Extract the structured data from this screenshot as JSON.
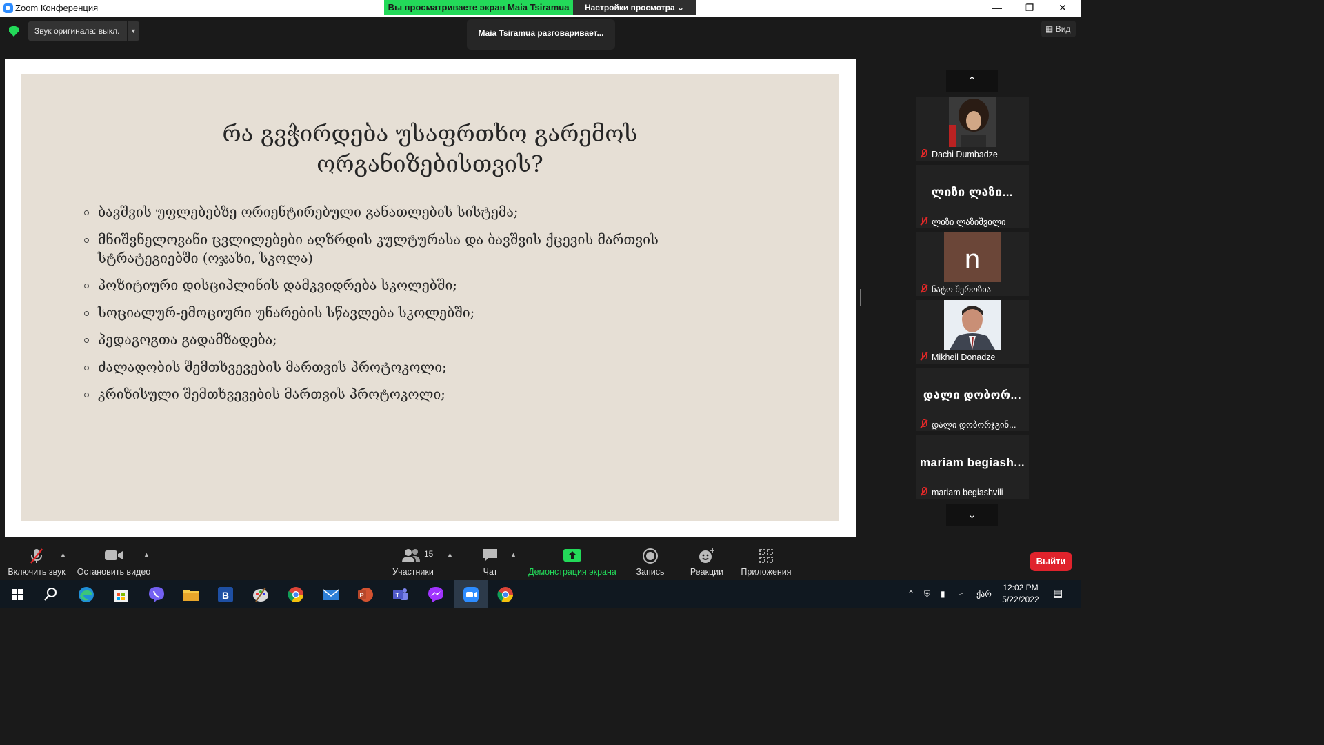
{
  "window": {
    "title": "Zoom Конференция"
  },
  "share_banner": {
    "viewing": "Вы просматриваете экран Maia Tsiramua",
    "view_settings": "Настройки просмотра ⌄"
  },
  "top": {
    "original_audio": "Звук оригинала: выкл.",
    "speaking": "Maia Tsiramua разговаривает...",
    "view": "Вид"
  },
  "slide": {
    "title_line1": "რა გვჭირდება უსაფრთხო გარემოს",
    "title_line2": "ორგანიზებისთვის?",
    "bullets": [
      "ბავშვის უფლებებზე ორიენტირებული განათლების სისტემა;",
      "მნიშვნელოვანი ცვლილებები აღზრდის კულტურასა და ბავშვის ქცევის მართვის სტრატეგიებში (ოჯახი, სკოლა)",
      "პოზიტიური დისციპლინის დამკვიდრება სკოლებში;",
      "სოციალურ-ემოციური უნარების სწავლება სკოლებში;",
      "პედაგოგთა გადამზადება;",
      "ძალადობის შემთხვევების მართვის პროტოკოლი;",
      "კრიზისული შემთხვევების მართვის პროტოკოლი;"
    ]
  },
  "participants": [
    {
      "name": "Dachi Dumbadze",
      "big": "",
      "avatar": "photo",
      "muted": true
    },
    {
      "name": "ლიზი ლაზიშვილი",
      "big": "ლიზი ლაზი...",
      "avatar": "none",
      "muted": true
    },
    {
      "name": "ნატო შეროზია",
      "big": "n",
      "avatar": "letter",
      "muted": true
    },
    {
      "name": "Mikheil Donadze",
      "big": "",
      "avatar": "photo",
      "muted": true
    },
    {
      "name": "დალი დობორჯგინ...",
      "big": "დალი დობორ...",
      "avatar": "none",
      "muted": true
    },
    {
      "name": "mariam begiashvili",
      "big": "mariam begiash...",
      "avatar": "none",
      "muted": true
    }
  ],
  "toolbar": {
    "unmute": "Включить звук",
    "stop_video": "Остановить видео",
    "participants": "Участники",
    "participants_count": "15",
    "chat": "Чат",
    "share": "Демонстрация экрана",
    "record": "Запись",
    "reactions": "Реакции",
    "apps": "Приложения",
    "leave": "Выйти"
  },
  "taskbar": {
    "time": "12:02 PM",
    "date": "5/22/2022",
    "lang": "ქარ",
    "apps": [
      "windows-start",
      "search",
      "edge",
      "microsoft-store",
      "viber",
      "file-explorer",
      "b-app",
      "paint",
      "chrome",
      "mail",
      "powerpoint",
      "teams",
      "messenger",
      "zoom",
      "chrome"
    ]
  },
  "colors": {
    "accent_green": "#23d959",
    "leave_red": "#e0232c",
    "slide_bg": "#e6dfd5",
    "zoom_blue": "#2d8cff"
  }
}
